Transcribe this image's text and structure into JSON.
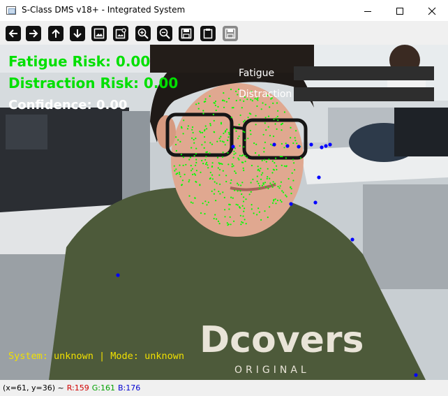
{
  "window": {
    "title": "S-Class DMS v18+ - Integrated System"
  },
  "toolbar": {
    "buttons": [
      {
        "icon": "arrow-left-icon"
      },
      {
        "icon": "arrow-right-icon"
      },
      {
        "icon": "arrow-up-icon"
      },
      {
        "icon": "arrow-down-icon"
      },
      {
        "icon": "image-icon"
      },
      {
        "icon": "image-settings-icon"
      },
      {
        "icon": "zoom-in-icon"
      },
      {
        "icon": "zoom-out-icon"
      },
      {
        "icon": "save-icon"
      },
      {
        "icon": "clipboard-icon"
      },
      {
        "icon": "save-disabled-icon"
      }
    ]
  },
  "overlay": {
    "fatigue_risk": "Fatigue Risk: 0.00",
    "distraction_risk": "Distraction Risk: 0.00",
    "confidence": "Confidence: 0.00",
    "bars": {
      "fatigue_label": "Fatigue",
      "fatigue_value": 0,
      "distraction_label": "Distraction",
      "distraction_value": 0
    },
    "system_line": "System: unknown | Mode: unknown"
  },
  "statusbar": {
    "coords": "(x=61, y=36) ~",
    "r": "R:159",
    "g": "G:161",
    "b": "B:176"
  },
  "colors": {
    "risk_text": "#00e000",
    "system_text": "#f0e000",
    "landmark_green": "#00ff00",
    "landmark_blue": "#0000ff",
    "bar_track": "#2e2e2e",
    "status_r": "#d00000",
    "status_g": "#00a000",
    "status_b": "#0000d0"
  }
}
